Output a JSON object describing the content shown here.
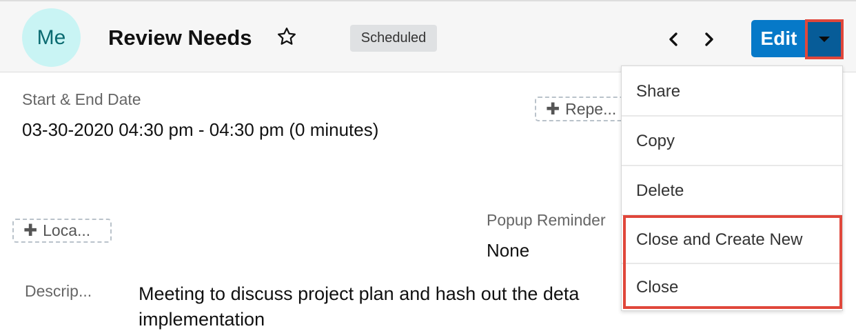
{
  "header": {
    "avatar_initials": "Me",
    "title": "Review Needs",
    "star_icon": "star-outline-icon",
    "status": "Scheduled",
    "prev_icon": "chevron-left-icon",
    "next_icon": "chevron-right-icon",
    "edit_label": "Edit",
    "actions_icon": "caret-down-icon"
  },
  "fields": {
    "start_end": {
      "label": "Start & End Date",
      "value": "03-30-2020 04:30 pm - 04:30 pm (0 minutes)"
    },
    "repeat_button": "Repe...",
    "location_button": "Loca...",
    "popup_reminder": {
      "label": "Popup Reminder",
      "value": "None"
    },
    "description": {
      "label": "Descrip...",
      "value": "Meeting to discuss project plan and hash out the deta\nimplementation"
    }
  },
  "actions_menu": {
    "items": [
      {
        "label": "Share"
      },
      {
        "label": "Copy"
      },
      {
        "label": "Delete"
      },
      {
        "label": "Close and Create New"
      },
      {
        "label": "Close"
      }
    ]
  },
  "colors": {
    "primary": "#0679c8",
    "primary_dark": "#075c98",
    "highlight": "#e0473b",
    "avatar_bg": "#c9f4f4",
    "avatar_text": "#0b6b71"
  }
}
